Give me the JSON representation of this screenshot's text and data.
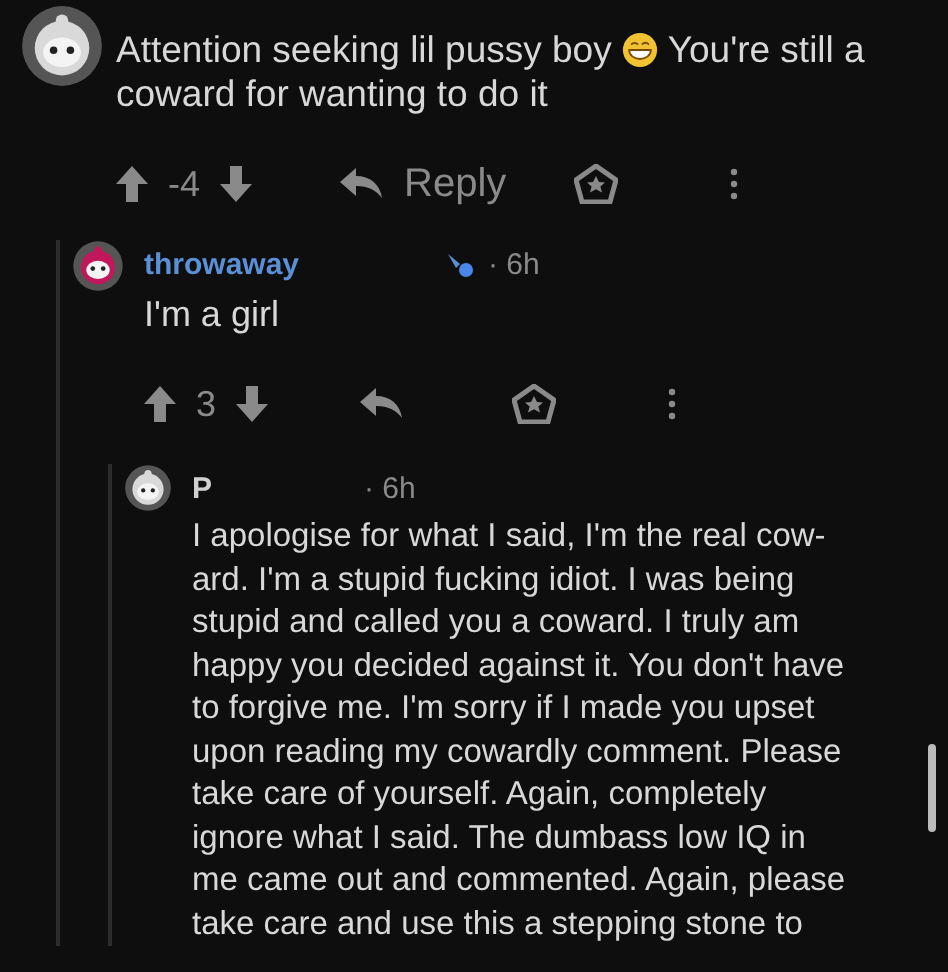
{
  "comments": [
    {
      "color": "#d9d9d9",
      "body_parts": [
        "Attention seeking lil pussy boy",
        "You're still a",
        "coward for wanting to do it"
      ],
      "actions": {
        "score": "-4",
        "reply": "Reply"
      },
      "children": [
        {
          "color": "#c2185b",
          "author": "throwaway",
          "flair": true,
          "time": "· 6h",
          "body_parts": [
            "I'm a girl"
          ],
          "actions": {
            "score": "3"
          },
          "children": [
            {
              "color": "#d9d9d9",
              "author": "P",
              "flair": false,
              "time": "· 6h",
              "body_parts": [
                "I apologise for what I said, I'm the real cow-\nard. I'm a stupid fucking idiot. I was being\nstupid and called you a coward. I truly am\nhappy you decided against it. You don't have\nto forgive me. I'm sorry if I made you upset\nupon reading my cowardly comment. Please\ntake care of yourself. Again, completely\nignore what I said. The dumbass low IQ in\nme came out and commented. Again, please\ntake care and use this a stepping stone to"
              ]
            }
          ]
        }
      ]
    }
  ]
}
